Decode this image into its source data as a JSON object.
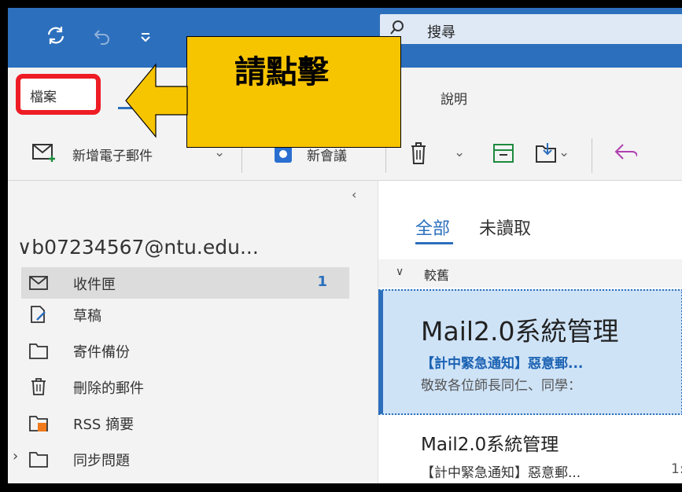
{
  "title_bar": {
    "sync_icon": "sync-icon",
    "undo_icon": "undo-icon",
    "customize_icon": "customize-icon",
    "search": {
      "placeholder": "搜尋"
    }
  },
  "menu": {
    "file_label": "檔案",
    "help_label": "說明"
  },
  "toolbar": {
    "new_email_label": "新增電子郵件",
    "new_meeting_label": "新會議"
  },
  "callout": {
    "text": "請點擊",
    "color": "#f7c400"
  },
  "folders": {
    "account": "∨b07234567@ntu.edu...",
    "items": [
      {
        "label": "收件匣",
        "count": "1",
        "icon": "inbox-icon"
      },
      {
        "label": "草稿",
        "icon": "drafts-icon"
      },
      {
        "label": "寄件備份",
        "icon": "folder-icon"
      },
      {
        "label": "刪除的郵件",
        "icon": "trash-icon"
      },
      {
        "label": "RSS 摘要",
        "icon": "rss-folder-icon"
      },
      {
        "label": "同步問題",
        "icon": "folder-icon"
      }
    ]
  },
  "message_list": {
    "tab_all": "全部",
    "tab_unread": "未讀取",
    "group_label": "較舊",
    "messages": [
      {
        "sender": "Mail2.0系統管理",
        "subject": "【計中緊急通知】惡意郵...",
        "preview": "敬致各位師長同仁、同學：",
        "side": "("
      },
      {
        "sender": "Mail2.0系統管理",
        "subject": "【計中緊急通知】惡意郵...",
        "side": "1:"
      }
    ]
  },
  "colors": {
    "accent": "#2c6fbd",
    "highlight": "#ee1c24"
  }
}
